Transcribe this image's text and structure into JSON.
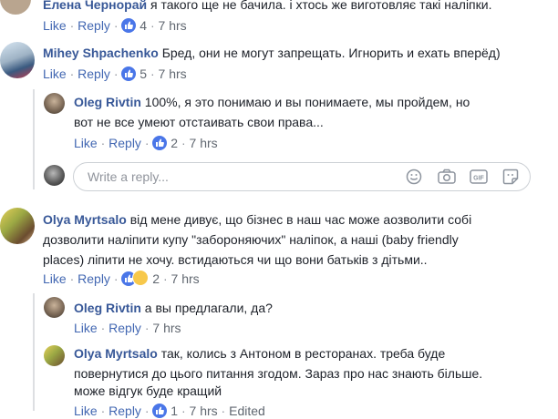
{
  "comments": [
    {
      "author": "Елена Чернорай",
      "lines": [
        "я такого ще не бачила. і хтось же виготовляє такі наліпки."
      ],
      "like": "Like",
      "reply": "Reply",
      "reactions": "4",
      "time": "7 hrs"
    },
    {
      "author": "Mihey Shpachenko",
      "lines": [
        "Бред, они не могут запрещать. Игнорить и ехать вперёд)"
      ],
      "like": "Like",
      "reply": "Reply",
      "reactions": "5",
      "time": "7 hrs",
      "replies": [
        {
          "author": "Oleg Rivtin",
          "lines": [
            "100%, я это понимаю и вы понимаете, мы пройдем, но",
            "вот не все умеют отстаивать свои права..."
          ],
          "like": "Like",
          "reply": "Reply",
          "reactions": "2",
          "time": "7 hrs"
        }
      ],
      "reply_placeholder": "Write a reply..."
    },
    {
      "author": "Olya Myrtsalo",
      "lines": [
        "від мене дивує, що бізнес в наш час може аозволити собі",
        "дозволити наліпити купу \"забороняючих\" наліпок, а наші (baby friendly",
        "places) ліпити не хочу. встидаються чи що вони батьків з дітьми.."
      ],
      "like": "Like",
      "reply": "Reply",
      "reactions": "2",
      "time": "7 hrs",
      "replies": [
        {
          "author": "Oleg Rivtin",
          "lines": [
            "а вы предлагали, да?"
          ],
          "like": "Like",
          "reply": "Reply",
          "time": "7 hrs"
        },
        {
          "author": "Olya Myrtsalo",
          "lines": [
            "так, колись з Антоном в ресторанах. треба буде",
            "повернутися до цього питання згодом. Зараз про нас знають більше.",
            "може відгук буде кращий"
          ],
          "like": "Like",
          "reply": "Reply",
          "reactions": "1",
          "time": "7 hrs",
          "edited": "Edited"
        }
      ]
    }
  ],
  "colors": {
    "author": "#385898",
    "link": "#4267b2",
    "like_badge": "#4a76e8"
  },
  "icons": [
    "like-thumb-icon",
    "haha-emoji-icon",
    "emoji-icon",
    "camera-icon",
    "gif-icon",
    "sticker-icon"
  ]
}
